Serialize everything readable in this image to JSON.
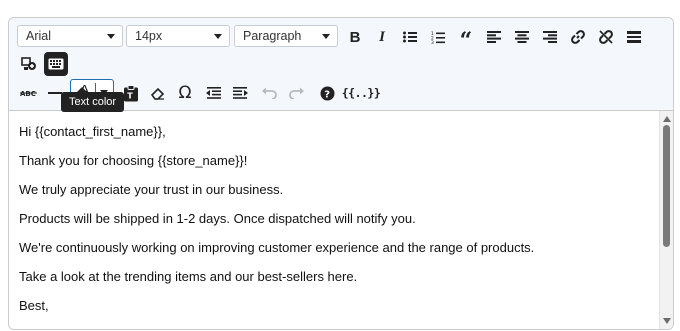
{
  "toolbar": {
    "font_family": {
      "selected": "Arial"
    },
    "font_size": {
      "selected": "14px"
    },
    "block_format": {
      "selected": "Paragraph"
    },
    "merge_tags_label": "{{..}}",
    "tooltip": "Text color"
  },
  "content": {
    "lines": [
      "Hi {{contact_first_name}},",
      "Thank you for choosing {{store_name}}!",
      "We truly appreciate your trust in our business.",
      "Products will be shipped in 1-2 days. Once dispatched will notify you.",
      "We're continuously working on improving customer experience and the range of products.",
      "Take a look at the trending items and our best-sellers here.",
      "Best,"
    ]
  },
  "colors": {
    "toolbar_bg": "#f4f7fb",
    "border": "#c8ccd1",
    "active_button": "#222222",
    "text_color_border": "#1f6fb2"
  },
  "icons": {
    "row1": [
      "bold-icon",
      "italic-icon",
      "bullet-list-icon",
      "numbered-list-icon",
      "blockquote-icon",
      "align-left-icon",
      "align-center-icon",
      "align-right-icon",
      "link-icon",
      "unlink-icon",
      "toolbar-toggle-icon"
    ],
    "row1b": [
      "insert-image-icon",
      "keyboard-icon"
    ],
    "row2": [
      "strikethrough-icon",
      "horizontal-line-icon",
      "text-color-icon",
      "paste-as-text-icon",
      "clear-formatting-icon",
      "special-character-icon",
      "outdent-icon",
      "indent-icon",
      "undo-icon",
      "redo-icon",
      "help-icon",
      "merge-tags-icon"
    ]
  }
}
